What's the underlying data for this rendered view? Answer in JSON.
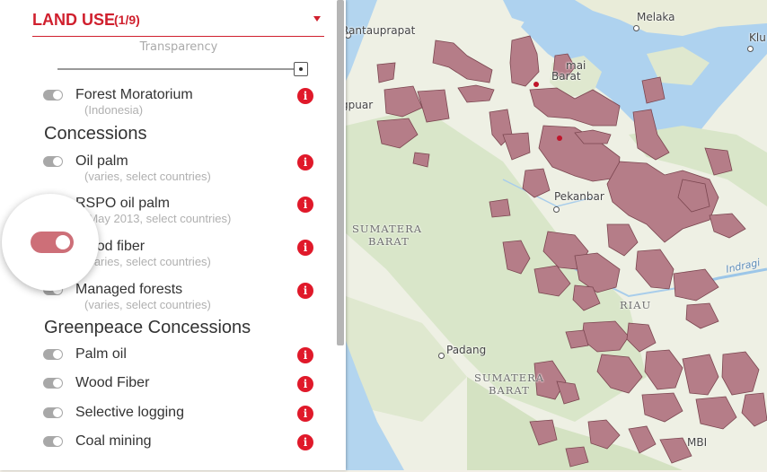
{
  "panel": {
    "title": "LAND USE",
    "count": "(1/9)",
    "transparency_label": "Transparency",
    "info_glyph": "i",
    "rows": [
      {
        "label": "Forest Moratorium",
        "sub": "(Indonesia)",
        "on": false
      },
      {
        "label": "Oil palm",
        "sub": "(varies, select countries)",
        "on": false
      },
      {
        "label": "RSPO oil palm",
        "sub": "(May 2013, select countries)",
        "on": false
      },
      {
        "label": "Wood fiber",
        "sub": "(varies, select countries)",
        "on": true
      },
      {
        "label": "Managed forests",
        "sub": "(varies, select countries)",
        "on": false
      },
      {
        "label": "Palm oil",
        "on": false
      },
      {
        "label": "Wood Fiber",
        "on": false
      },
      {
        "label": "Selective logging",
        "on": false
      },
      {
        "label": "Coal mining",
        "on": false
      }
    ],
    "groups": [
      "Concessions",
      "Greenpeace Concessions"
    ]
  },
  "map": {
    "places": [
      {
        "name": "Rantauprapat"
      },
      {
        "name": "Melaka"
      },
      {
        "name": "Klu"
      },
      {
        "name": "mai"
      },
      {
        "name": "Barat"
      },
      {
        "name": "gpuar"
      },
      {
        "name": "Pekanbar"
      },
      {
        "name": "Padang"
      },
      {
        "name": "MBI"
      }
    ],
    "regions": [
      {
        "name": "SUMATERA BARAT",
        "lines": [
          "SUMATERA",
          "BARAT"
        ]
      },
      {
        "name": "RIAU"
      },
      {
        "name": "SUMATERA BARAT",
        "lines": [
          "SUMATERA",
          "BARAT"
        ]
      }
    ],
    "water": "Indragi",
    "colors": {
      "land": "#f2efe6",
      "green": "#d7e4c6",
      "water": "#aed2ef",
      "concession": "#b57d88",
      "concession_stroke": "#7b4650",
      "accent": "#d0202e"
    }
  }
}
